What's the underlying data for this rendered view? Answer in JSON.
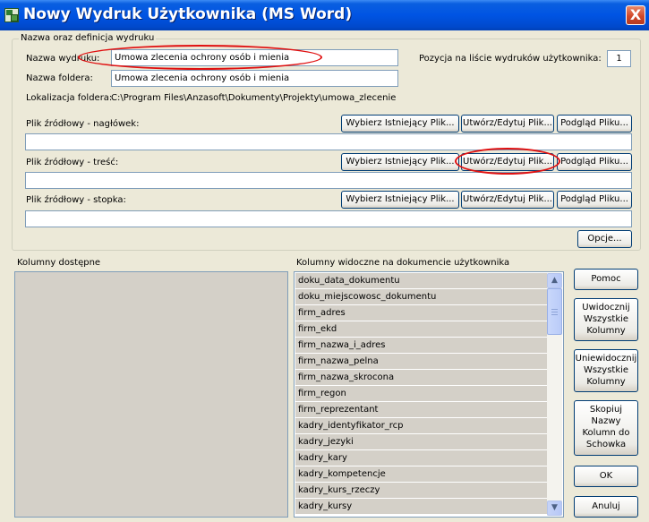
{
  "window": {
    "title": "Nowy Wydruk Użytkownika (MS Word)",
    "close_glyph": "X",
    "title_color": "#0054e3"
  },
  "group": {
    "caption": "Nazwa oraz definicja wydruku",
    "name_label": "Nazwa wydruku:",
    "name_value": "Umowa zlecenia ochrony osób i mienia",
    "folder_label": "Nazwa foldera:",
    "folder_value": "Umowa zlecenia ochrony osób i mienia",
    "position_label": "Pozycja na liście wydruków użytkownika:",
    "position_value": "1",
    "location_label": "Lokalizacja foldera:",
    "location_value": "C:\\Program Files\\Anzasoft\\Dokumenty\\Projekty\\umowa_zlecenie"
  },
  "sources": [
    {
      "label": "Plik źródłowy - nagłówek:",
      "value": ""
    },
    {
      "label": "Plik źródłowy - treść:",
      "value": ""
    },
    {
      "label": "Plik źródłowy - stopka:",
      "value": ""
    }
  ],
  "source_buttons": {
    "choose": "Wybierz Istniejący Plik...",
    "create": "Utwórz/Edytuj Plik...",
    "preview": "Podgląd Pliku..."
  },
  "options_button": "Opcje...",
  "available_columns_label": "Kolumny dostępne",
  "visible_columns_label": "Kolumny widoczne na dokumencie użytkownika",
  "visible_columns": [
    "doku_data_dokumentu",
    "doku_miejscowosc_dokumentu",
    "firm_adres",
    "firm_ekd",
    "firm_nazwa_i_adres",
    "firm_nazwa_pelna",
    "firm_nazwa_skrocona",
    "firm_regon",
    "firm_reprezentant",
    "kadry_identyfikator_rcp",
    "kadry_jezyki",
    "kadry_kary",
    "kadry_kompetencje",
    "kadry_kurs_rzeczy",
    "kadry_kursy"
  ],
  "side_buttons": {
    "help": "Pomoc",
    "show_all": "Uwidocznij Wszystkie Kolumny",
    "hide_all": "Uniewidocznij Wszystkie Kolumny",
    "copy": "Skopiuj Nazwy Kolumn do Schowka",
    "ok": "OK",
    "cancel": "Anuluj"
  },
  "icons": {
    "app": "word-document-icon",
    "scroll_up": "▲",
    "scroll_down": "▼"
  },
  "annotation_color": "#e01010"
}
